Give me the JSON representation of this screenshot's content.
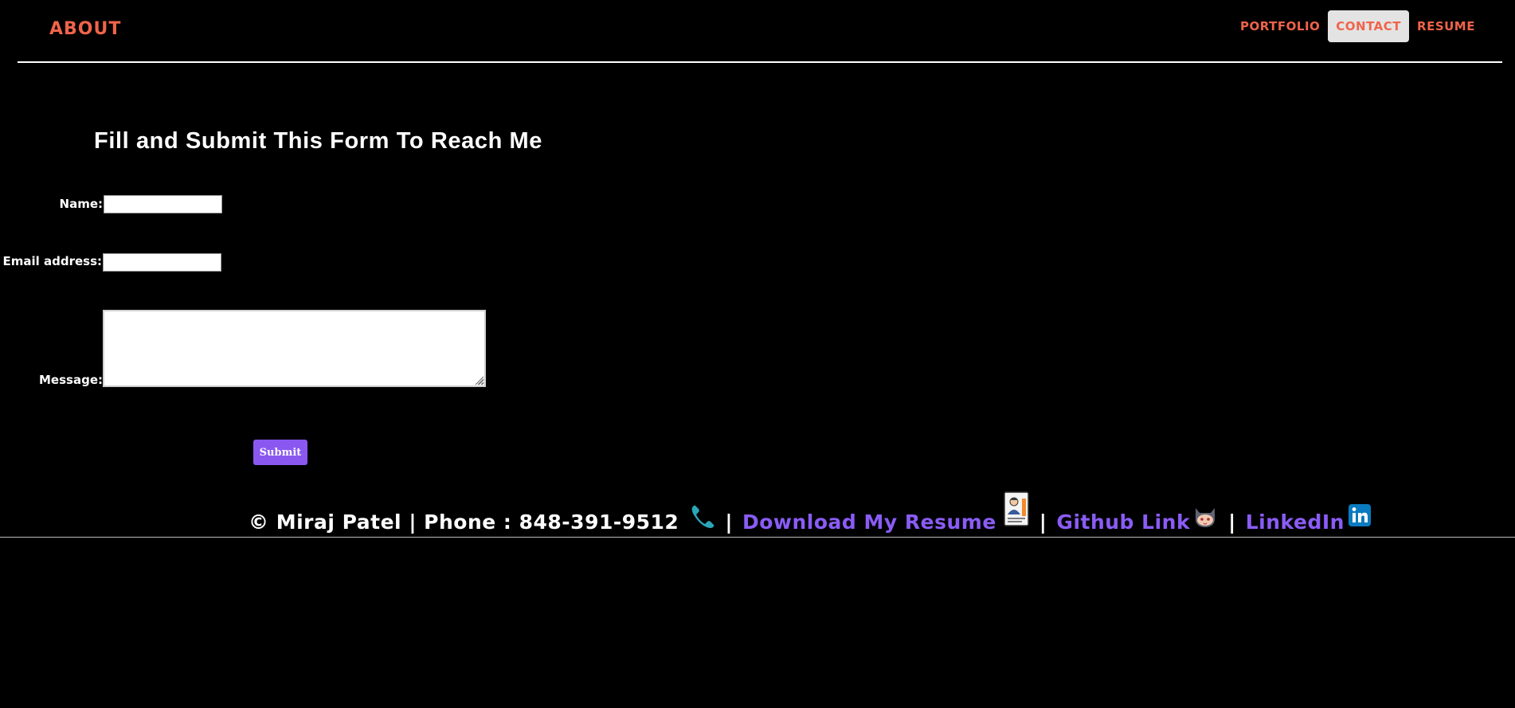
{
  "nav": {
    "about": "ABOUT",
    "links": [
      {
        "label": "PORTFOLIO",
        "active": false
      },
      {
        "label": "CONTACT",
        "active": true
      },
      {
        "label": "RESUME",
        "active": false
      }
    ]
  },
  "form": {
    "title": "Fill and Submit This Form To Reach Me",
    "name_label": "Name:",
    "name_value": "",
    "email_label": "Email address:",
    "email_value": "",
    "message_label": "Message:",
    "message_value": "",
    "submit_label": "Submit"
  },
  "footer": {
    "copyright": "© Miraj Patel | Phone : 848-391-9512",
    "separator": "|",
    "resume_link": "Download My Resume",
    "github_link": "Github Link",
    "linkedin_link": "LinkedIn"
  },
  "icons": {
    "phone": "phone-icon",
    "resume": "resume-document-icon",
    "github": "github-octocat-icon",
    "linkedin": "linkedin-icon"
  },
  "colors": {
    "background": "#000000",
    "nav_accent": "#f0644a",
    "link_purple": "#8a5cf6",
    "submit_bg": "#8a58f0",
    "active_tab_bg": "#e3e3e3"
  }
}
